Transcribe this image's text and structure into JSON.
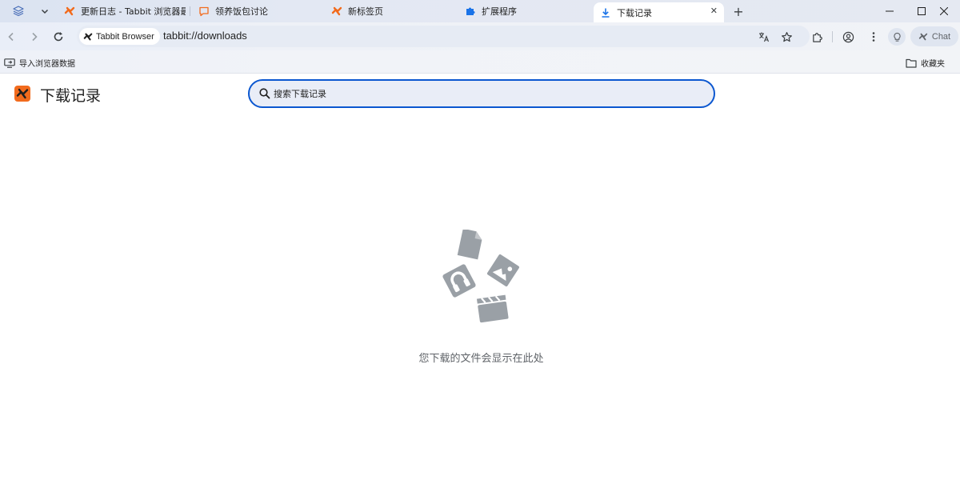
{
  "tabs": [
    {
      "title": "更新日志 - Tabbit 浏览器最新",
      "icon": "tabbit-logo-icon",
      "active": false
    },
    {
      "title": "领养饭包讨论",
      "icon": "comment-icon",
      "active": false
    },
    {
      "title": "新标签页",
      "icon": "tabbit-logo-icon",
      "active": false
    },
    {
      "title": "扩展程序",
      "icon": "puzzle-icon",
      "active": false
    },
    {
      "title": "下载记录",
      "icon": "download-icon",
      "active": true
    }
  ],
  "toolbar": {
    "site_chip": "Tabbit Browser",
    "url": "tabbit://downloads",
    "chat_label": "Chat"
  },
  "bookmarks": {
    "import_label": "导入浏览器数据",
    "favorites_label": "收藏夹"
  },
  "page": {
    "title": "下载记录",
    "search_placeholder": "搜索下载记录",
    "empty_message": "您下载的文件会显示在此处"
  },
  "colors": {
    "accent": "#0b57d0",
    "brand": "#f26b1d",
    "illustration": "#9aa0a6"
  }
}
